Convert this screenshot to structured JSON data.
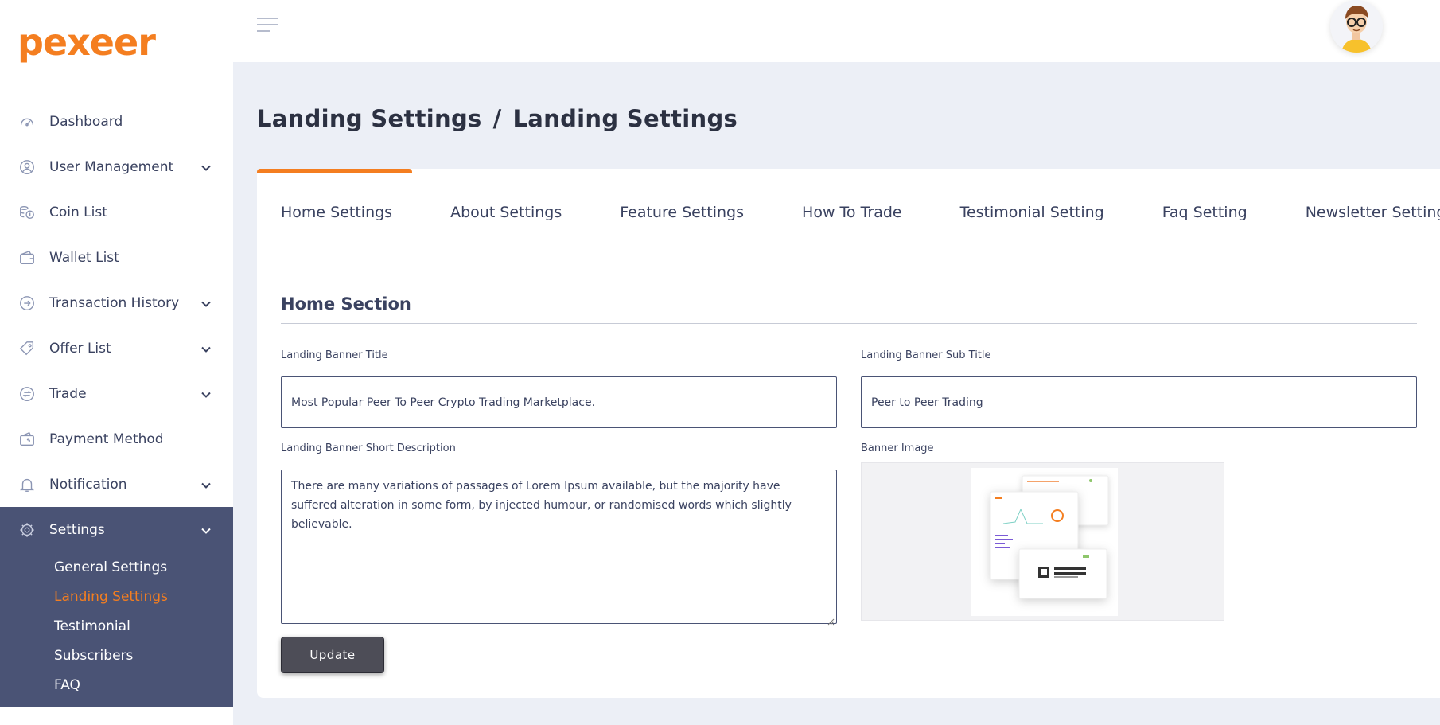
{
  "app": {
    "logo_text": "pexeer",
    "brand_color": "#f47e20",
    "sidebar_active_bg": "#4a5375"
  },
  "sidebar": {
    "items": [
      {
        "label": "Dashboard",
        "icon": "speedometer-icon",
        "has_children": false
      },
      {
        "label": "User Management",
        "icon": "user-circle-icon",
        "has_children": true
      },
      {
        "label": "Coin List",
        "icon": "coins-icon",
        "has_children": false
      },
      {
        "label": "Wallet List",
        "icon": "wallet-icon",
        "has_children": false
      },
      {
        "label": "Transaction History",
        "icon": "transaction-icon",
        "has_children": true
      },
      {
        "label": "Offer List",
        "icon": "tag-icon",
        "has_children": true
      },
      {
        "label": "Trade",
        "icon": "exchange-icon",
        "has_children": true
      },
      {
        "label": "Payment Method",
        "icon": "payment-icon",
        "has_children": false
      },
      {
        "label": "Notification",
        "icon": "bell-icon",
        "has_children": true
      }
    ],
    "settings": {
      "label": "Settings",
      "icon": "gear-icon",
      "children": [
        {
          "label": "General Settings",
          "active": false
        },
        {
          "label": "Landing Settings",
          "active": true
        },
        {
          "label": "Testimonial",
          "active": false
        },
        {
          "label": "Subscribers",
          "active": false
        },
        {
          "label": "FAQ",
          "active": false
        }
      ]
    }
  },
  "header": {
    "breadcrumb_parent": "Landing Settings",
    "breadcrumb_separator": "/",
    "breadcrumb_current": "Landing Settings"
  },
  "tabs": [
    "Home Settings",
    "About Settings",
    "Feature Settings",
    "How To Trade",
    "Testimonial Setting",
    "Faq Setting",
    "Newsletter Setting"
  ],
  "form": {
    "section_title": "Home Section",
    "banner_title_label": "Landing Banner Title",
    "banner_title_value": "Most Popular Peer To Peer Crypto Trading Marketplace.",
    "banner_subtitle_label": "Landing Banner Sub Title",
    "banner_subtitle_value": "Peer to Peer Trading",
    "short_description_label": "Landing Banner Short Description",
    "short_description_value": "There are many variations of passages of Lorem Ipsum available, but the majority have suffered alteration in some form, by injected humour, or randomised words which slightly believable.",
    "banner_image_label": "Banner Image",
    "update_label": "Update"
  }
}
